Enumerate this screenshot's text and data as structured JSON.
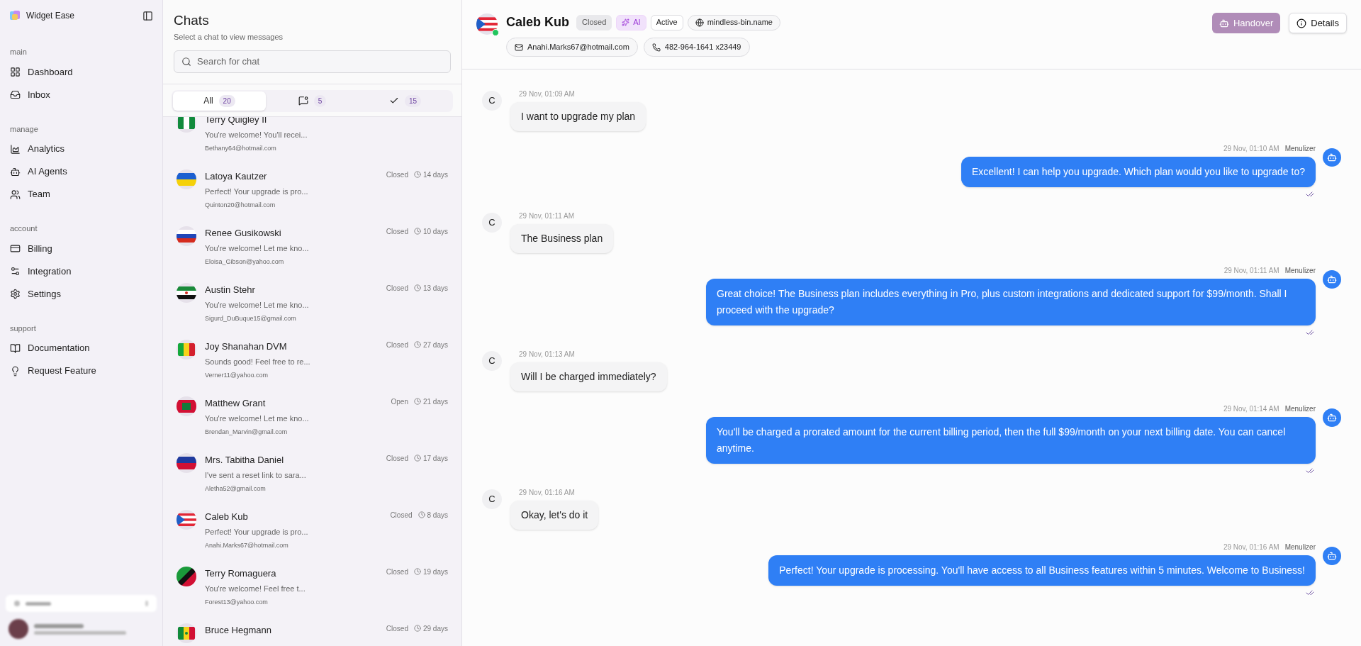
{
  "sidebar": {
    "brand": "Widget Ease",
    "sections": [
      {
        "title": "main",
        "items": [
          {
            "label": "Dashboard",
            "kind": "dashboard"
          },
          {
            "label": "Inbox",
            "kind": "inbox"
          }
        ]
      },
      {
        "title": "manage",
        "items": [
          {
            "label": "Analytics",
            "kind": "analytics"
          },
          {
            "label": "AI Agents",
            "kind": "agents"
          },
          {
            "label": "Team",
            "kind": "team"
          }
        ]
      },
      {
        "title": "account",
        "items": [
          {
            "label": "Billing",
            "kind": "billing"
          },
          {
            "label": "Integration",
            "kind": "integration"
          },
          {
            "label": "Settings",
            "kind": "settings"
          }
        ]
      },
      {
        "title": "support",
        "items": [
          {
            "label": "Documentation",
            "kind": "docs"
          },
          {
            "label": "Request Feature",
            "kind": "feature"
          }
        ]
      }
    ]
  },
  "chat_list": {
    "title": "Chats",
    "subtitle": "Select a chat to view messages",
    "search": {
      "placeholder": "Search for chat"
    },
    "tabs": [
      {
        "kind": "all",
        "label": "All",
        "count": "20",
        "selected": true
      },
      {
        "kind": "open",
        "count": "5",
        "selected": false
      },
      {
        "kind": "closed",
        "count": "15",
        "selected": false
      }
    ],
    "chats": [
      {
        "name": "Terry Quigley II",
        "preview": "You're welcome! You'll recei...",
        "email": "Bethany64@hotmail.com"
      },
      {
        "name": "Latoya Kautzer",
        "status": "Closed",
        "age": "14 days",
        "preview": "Perfect! Your upgrade is pro...",
        "email": "Quinton20@hotmail.com"
      },
      {
        "name": "Renee Gusikowski",
        "status": "Closed",
        "age": "10 days",
        "preview": "You're welcome! Let me kno...",
        "email": "Eloisa_Gibson@yahoo.com"
      },
      {
        "name": "Austin Stehr",
        "status": "Closed",
        "age": "13 days",
        "preview": "You're welcome! Let me kno...",
        "email": "Sigurd_DuBuque15@gmail.com"
      },
      {
        "name": "Joy Shanahan DVM",
        "status": "Closed",
        "age": "27 days",
        "preview": "Sounds good! Feel free to re...",
        "email": "Verner11@yahoo.com"
      },
      {
        "name": "Matthew Grant",
        "status": "Open",
        "age": "21 days",
        "preview": "You're welcome! Let me kno...",
        "email": "Brendan_Marvin@gmail.com"
      },
      {
        "name": "Mrs. Tabitha Daniel",
        "status": "Closed",
        "age": "17 days",
        "preview": "I've sent a reset link to sara...",
        "email": "Aletha52@gmail.com"
      },
      {
        "name": "Caleb Kub",
        "status": "Closed",
        "age": "8 days",
        "preview": "Perfect! Your upgrade is pro...",
        "email": "Anahi.Marks67@hotmail.com"
      },
      {
        "name": "Terry Romaguera",
        "status": "Closed",
        "age": "19 days",
        "preview": "You're welcome! Feel free t...",
        "email": "Forest13@yahoo.com"
      },
      {
        "name": "Bruce Hegmann",
        "status": "Closed",
        "age": "29 days"
      }
    ]
  },
  "conversation": {
    "header": {
      "name": "Caleb Kub",
      "online": true,
      "badges": [
        {
          "kind": "status",
          "text": "Closed"
        },
        {
          "kind": "ai",
          "text": "AI"
        },
        {
          "kind": "state",
          "text": "Active"
        },
        {
          "kind": "website",
          "text": "mindless-bin.name"
        }
      ],
      "contacts": [
        {
          "kind": "email",
          "text": "Anahi.Marks67@hotmail.com"
        },
        {
          "kind": "phone",
          "text": "482-964-1641 x23449"
        }
      ],
      "buttons": [
        {
          "kind": "handover",
          "label": "Handover"
        },
        {
          "kind": "details",
          "label": "Details"
        }
      ]
    },
    "messages": [
      {
        "kind": "customer",
        "avatar": "C",
        "time": "29 Nov, 01:09 AM",
        "text": "I want to upgrade my plan"
      },
      {
        "kind": "agent",
        "sender": "Menulizer",
        "time": "29 Nov, 01:10 AM",
        "text": "Excellent! I can help you upgrade. Which plan would you like to upgrade to?"
      },
      {
        "kind": "customer",
        "avatar": "C",
        "time": "29 Nov, 01:11 AM",
        "text": "The Business plan"
      },
      {
        "kind": "agent",
        "sender": "Menulizer",
        "time": "29 Nov, 01:11 AM",
        "text": "Great choice! The Business plan includes everything in Pro, plus custom integrations and dedicated support for $99/month. Shall I proceed with the upgrade?"
      },
      {
        "kind": "customer",
        "avatar": "C",
        "time": "29 Nov, 01:13 AM",
        "text": "Will I be charged immediately?"
      },
      {
        "kind": "agent",
        "sender": "Menulizer",
        "time": "29 Nov, 01:14 AM",
        "text": "You'll be charged a prorated amount for the current billing period, then the full $99/month on your next billing date. You can cancel anytime."
      },
      {
        "kind": "customer",
        "avatar": "C",
        "time": "29 Nov, 01:16 AM",
        "text": "Okay, let's do it"
      },
      {
        "kind": "agent",
        "sender": "Menulizer",
        "time": "29 Nov, 01:16 AM",
        "text": "Perfect! Your upgrade is processing. You'll have access to all Business features within 5 minutes. Welcome to Business!"
      }
    ]
  }
}
